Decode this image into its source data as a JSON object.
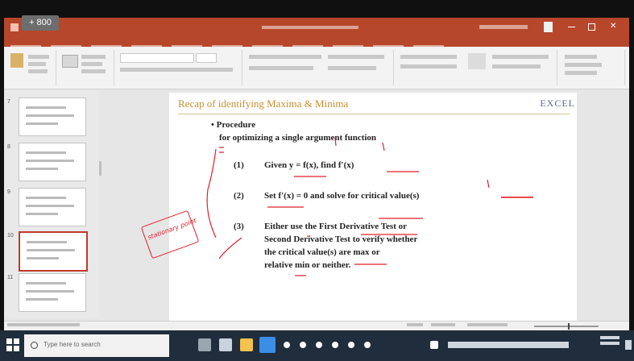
{
  "zoom_badge": "+ 800",
  "slide": {
    "title": "Recap of identifying Maxima & Minima",
    "logo": "EXCEL",
    "bullet": "• Procedure",
    "subtitle": "for optimizing a single argument function",
    "step1_num": "(1)",
    "step1_text": "Given  y = f(x), find  f′(x)",
    "step2_num": "(2)",
    "step2_text": "Set  f′(x) = 0  and solve for critical value(s)",
    "step3_num": "(3)",
    "step3_line1": "Either use the First Derivative Test or",
    "step3_line2": "Second Derivative Test to verify whether",
    "step3_line3": "the critical value(s) are max or",
    "step3_line4": "relative min or neither."
  },
  "annotation": "stationary point",
  "taskbar": {
    "search_placeholder": "Type here to search"
  },
  "colors": {
    "titlebar": "#b7472a",
    "annotation": "#e0202a",
    "taskbar": "#1f2d3d",
    "slide_title": "#c8902f"
  }
}
